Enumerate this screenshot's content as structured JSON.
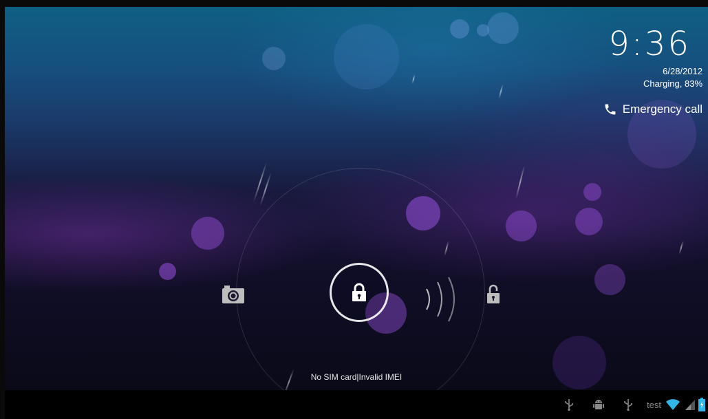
{
  "clock": {
    "time": "9:36",
    "date": "6/28/2012",
    "charging": "Charging, 83%"
  },
  "emergency": {
    "label": "Emergency call",
    "icon": "phone-icon"
  },
  "lockscreen": {
    "handle_icon": "lock-icon",
    "left_target_icon": "camera-icon",
    "right_target_icon": "unlock-icon",
    "carrier_text": "No SIM card|Invalid IMEI"
  },
  "status_bar": {
    "icons": [
      "usb-icon",
      "android-debug-icon",
      "usb-icon",
      "wifi-icon",
      "signal-icon",
      "battery-charging-icon"
    ],
    "network_name": "test"
  },
  "colors": {
    "wifi": "#33b5e5",
    "battery": "#33b5e5",
    "status_gray": "#8a8a8a"
  }
}
